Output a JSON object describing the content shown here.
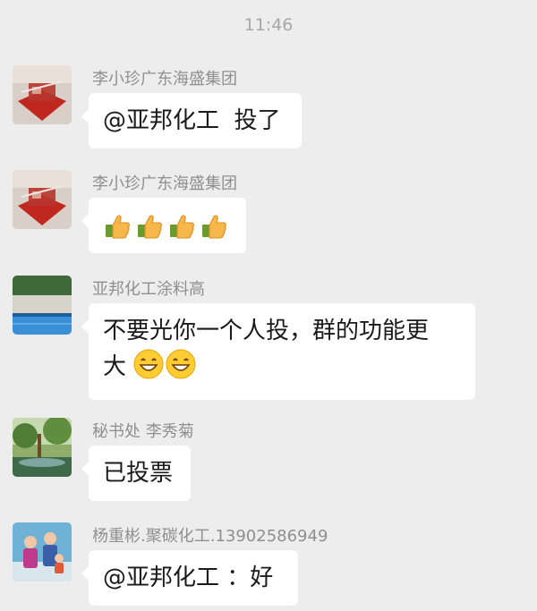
{
  "timestamp": "11:46",
  "messages": [
    {
      "sender": "李小珍广东海盛集团",
      "text": "@亚邦化工  投了",
      "avatar": "red-gift-avatar"
    },
    {
      "sender": "李小珍广东海盛集团",
      "emoji": [
        "thumbs-up-icon",
        "thumbs-up-icon",
        "thumbs-up-icon",
        "thumbs-up-icon"
      ],
      "avatar": "red-gift-avatar"
    },
    {
      "sender": "亚邦化工涂料高",
      "line1": "不要光你一个人投，群的功能更",
      "line2": "大",
      "line2_emoji": [
        "grin-icon",
        "grin-icon"
      ],
      "avatar": "pool-avatar"
    },
    {
      "sender": "秘书处 李秀菊",
      "text": "已投票",
      "avatar": "garden-avatar"
    },
    {
      "sender": "杨重彬.聚碳化工.13902586949",
      "text": "@亚邦化工 ：好",
      "avatar": "family-photo-avatar"
    }
  ],
  "colors": {
    "background": "#ededed",
    "bubble": "#ffffff",
    "sender": "#8f8f8f",
    "timestamp": "#a8a8a8"
  }
}
